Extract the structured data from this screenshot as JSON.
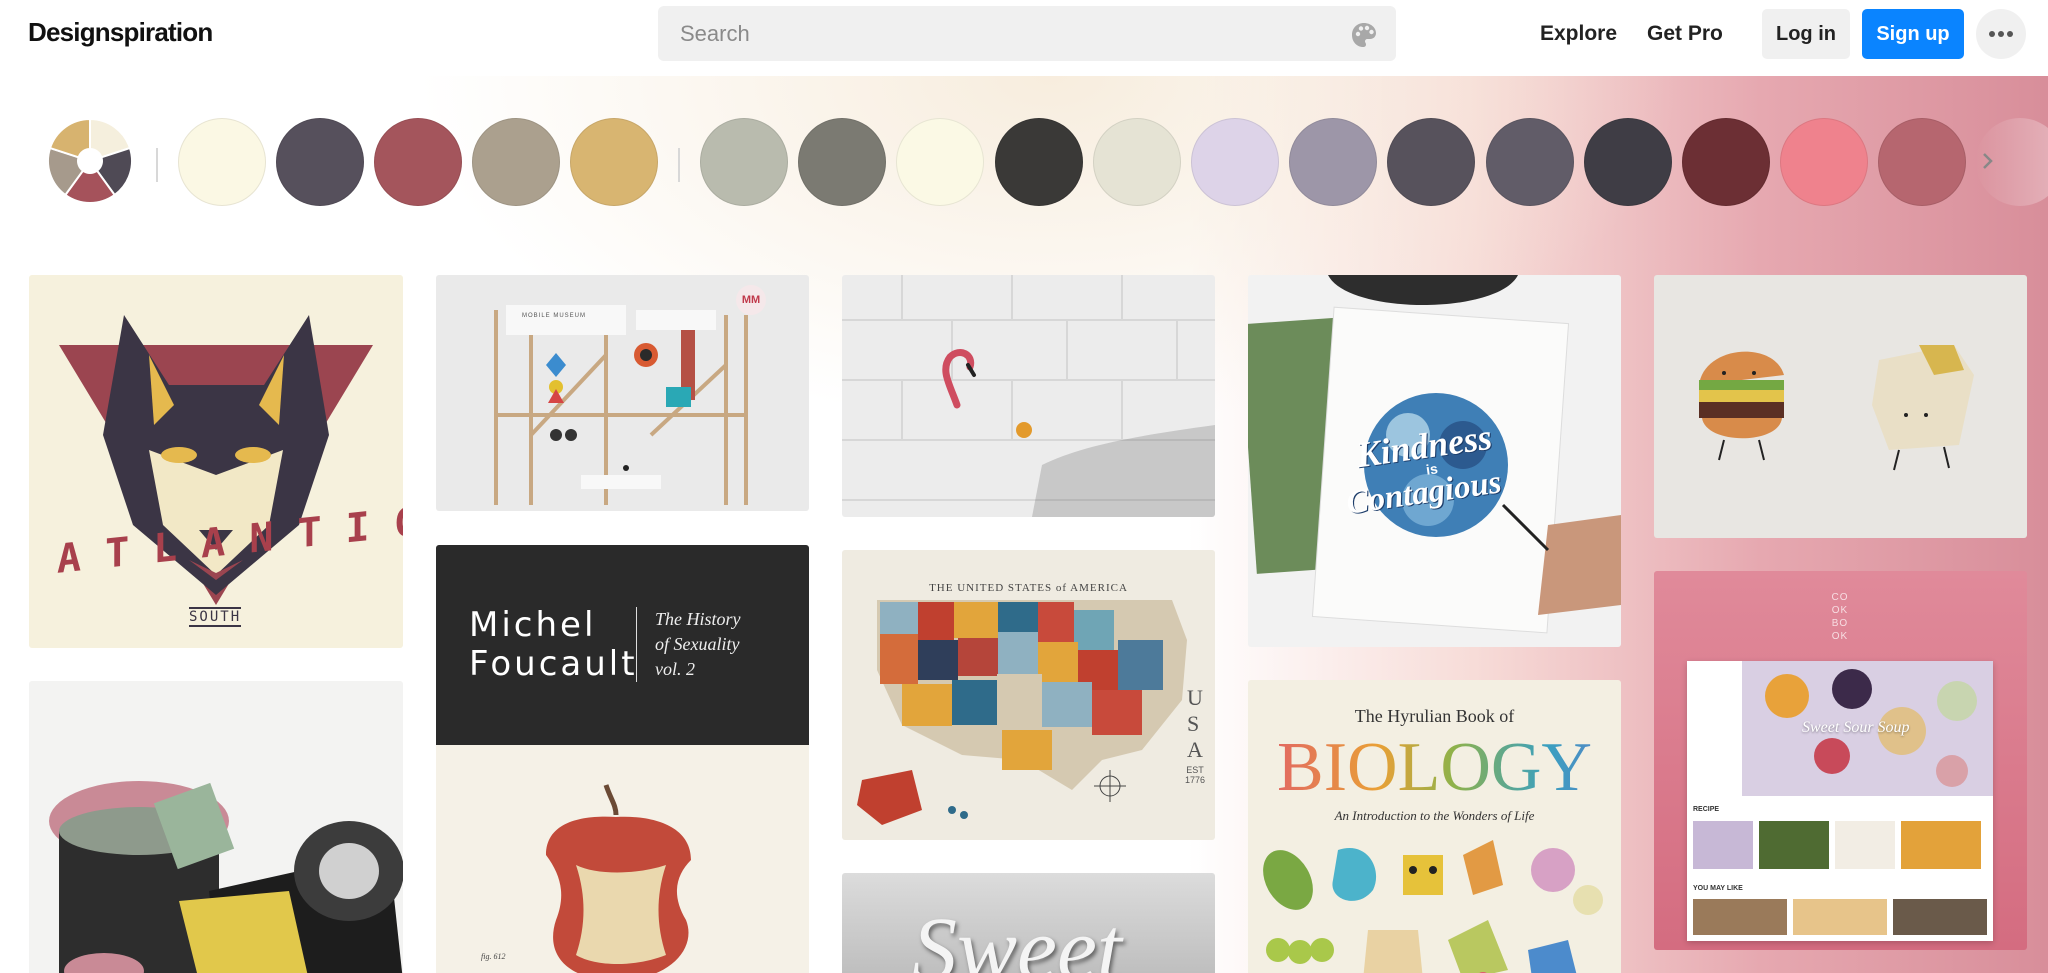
{
  "header": {
    "logo": "Designspiration",
    "search_placeholder": "Search",
    "nav": {
      "explore": "Explore",
      "get_pro": "Get Pro"
    },
    "login": "Log in",
    "signup": "Sign up",
    "accent": "#0a84ff"
  },
  "icons": [
    "palette-icon",
    "more-dots-icon",
    "color-wheel-icon",
    "chevron-right-icon"
  ],
  "color_wheel": [
    "#f5efdd",
    "#4f4a55",
    "#a5525b",
    "#a69a8c",
    "#d7b36f"
  ],
  "selected_colors": [
    "#fbf8e4",
    "#56505c",
    "#a4555c",
    "#aba08e",
    "#d8b571"
  ],
  "suggested_colors": [
    "#b9bbae",
    "#7b7a72",
    "#fbf9e5",
    "#3a3937",
    "#e5e3d4",
    "#ddd3e8",
    "#9d96a8",
    "#57525c",
    "#615c68",
    "#3f3d45",
    "#6c2f34",
    "#ef828d",
    "#b6666f"
  ],
  "tiles": {
    "atlantic": {
      "title": "ATLANTIC",
      "sub": "SOUTH"
    },
    "museum": {
      "sign": "MOBILE MUSEUM",
      "badge": "MM"
    },
    "foucault": {
      "author_line1": "Michel",
      "author_line2": "Foucault",
      "title_line1": "The History",
      "title_line2": "of Sexuality",
      "title_line3": "vol. 2",
      "fig": "fig. 612"
    },
    "map": {
      "header": "THE UNITED STATES of AMERICA",
      "side": "USA",
      "est": "EST 1776"
    },
    "kindness": {
      "line1": "Kindness",
      "line2": "is",
      "line3": "Contagious"
    },
    "biology": {
      "top": "The Hyrulian Book of",
      "big": "BIOLOGY",
      "sub": "An Introduction to the Wonders of Life"
    },
    "cookbook": {
      "brand": "COOKBOOK",
      "hero": "Sweet Sour Soup",
      "recipe": "RECIPE",
      "you_may_like": "YOU MAY LIKE"
    },
    "sweet": {
      "script": "Sweet"
    }
  }
}
